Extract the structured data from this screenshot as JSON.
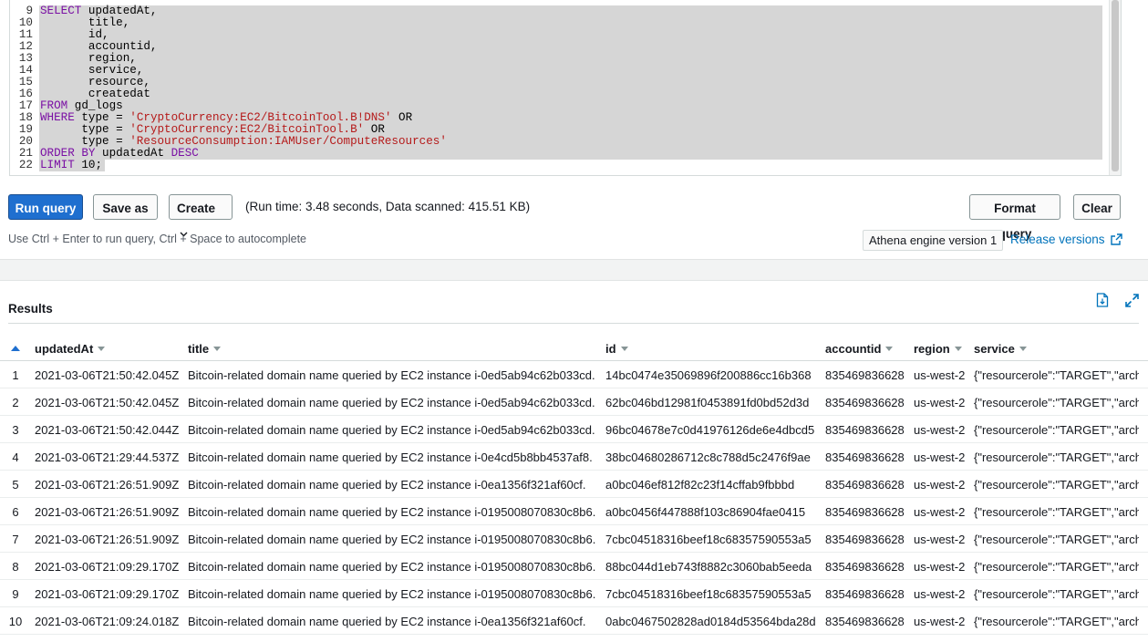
{
  "editor": {
    "lines": [
      {
        "n": "9",
        "parts": [
          {
            "t": "SELECT",
            "c": "kw"
          },
          {
            "t": " updatedAt,"
          }
        ]
      },
      {
        "n": "10",
        "parts": [
          {
            "t": "       title,"
          }
        ]
      },
      {
        "n": "11",
        "parts": [
          {
            "t": "       id,"
          }
        ]
      },
      {
        "n": "12",
        "parts": [
          {
            "t": "       accountid,"
          }
        ]
      },
      {
        "n": "13",
        "parts": [
          {
            "t": "       region,"
          }
        ]
      },
      {
        "n": "14",
        "parts": [
          {
            "t": "       service,"
          }
        ]
      },
      {
        "n": "15",
        "parts": [
          {
            "t": "       resource,"
          }
        ]
      },
      {
        "n": "16",
        "parts": [
          {
            "t": "       createdat"
          }
        ]
      },
      {
        "n": "17",
        "parts": [
          {
            "t": "FROM",
            "c": "kw"
          },
          {
            "t": " gd_logs"
          }
        ]
      },
      {
        "n": "18",
        "parts": [
          {
            "t": "WHERE",
            "c": "kw"
          },
          {
            "t": " type = "
          },
          {
            "t": "'CryptoCurrency:EC2/BitcoinTool.B!DNS'",
            "c": "str"
          },
          {
            "t": " OR"
          }
        ]
      },
      {
        "n": "19",
        "parts": [
          {
            "t": "      type = "
          },
          {
            "t": "'CryptoCurrency:EC2/BitcoinTool.B'",
            "c": "str"
          },
          {
            "t": " OR"
          }
        ]
      },
      {
        "n": "20",
        "parts": [
          {
            "t": "      type = "
          },
          {
            "t": "'ResourceConsumption:IAMUser/ComputeResources'",
            "c": "str"
          }
        ]
      },
      {
        "n": "21",
        "parts": [
          {
            "t": "ORDER BY",
            "c": "kw"
          },
          {
            "t": " updatedAt "
          },
          {
            "t": "DESC",
            "c": "kw"
          }
        ]
      },
      {
        "n": "22",
        "parts": [
          {
            "t": "LIMIT",
            "c": "kw"
          },
          {
            "t": " 10;"
          }
        ]
      }
    ]
  },
  "toolbar": {
    "run_label": "Run query",
    "save_label": "Save as",
    "create_label": "Create",
    "run_info": "(Run time: 3.48 seconds, Data scanned: 415.51 KB)",
    "format_label": "Format query",
    "clear_label": "Clear",
    "hint": "Use Ctrl + Enter to run query, Ctrl + Space to autocomplete",
    "engine": "Athena engine version 1",
    "release_label": "Release versions"
  },
  "results": {
    "title": "Results",
    "columns": [
      "updatedAt",
      "title",
      "id",
      "accountid",
      "region",
      "service"
    ],
    "rows": [
      [
        "1",
        "2021-03-06T21:50:42.045Z",
        "Bitcoin-related domain name queried by EC2 instance i-0ed5ab94c62b033cd.",
        "14bc0474e35069896f200886cc16b368",
        "835469836628",
        "us-west-2",
        "{\"resourcerole\":\"TARGET\",\"arch"
      ],
      [
        "2",
        "2021-03-06T21:50:42.045Z",
        "Bitcoin-related domain name queried by EC2 instance i-0ed5ab94c62b033cd.",
        "62bc046bd12981f0453891fd0bd52d3d",
        "835469836628",
        "us-west-2",
        "{\"resourcerole\":\"TARGET\",\"arch"
      ],
      [
        "3",
        "2021-03-06T21:50:42.044Z",
        "Bitcoin-related domain name queried by EC2 instance i-0ed5ab94c62b033cd.",
        "96bc04678e7c0d41976126de6e4dbcd5",
        "835469836628",
        "us-west-2",
        "{\"resourcerole\":\"TARGET\",\"arch"
      ],
      [
        "4",
        "2021-03-06T21:29:44.537Z",
        "Bitcoin-related domain name queried by EC2 instance i-0e4cd5b8bb4537af8.",
        "38bc04680286712c8c788d5c2476f9ae",
        "835469836628",
        "us-west-2",
        "{\"resourcerole\":\"TARGET\",\"arch"
      ],
      [
        "5",
        "2021-03-06T21:26:51.909Z",
        "Bitcoin-related domain name queried by EC2 instance i-0ea1356f321af60cf.",
        "a0bc046ef812f82c23f14cffab9fbbbd",
        "835469836628",
        "us-west-2",
        "{\"resourcerole\":\"TARGET\",\"arch"
      ],
      [
        "6",
        "2021-03-06T21:26:51.909Z",
        "Bitcoin-related domain name queried by EC2 instance i-0195008070830c8b6.",
        "a0bc0456f447888f103c86904fae0415",
        "835469836628",
        "us-west-2",
        "{\"resourcerole\":\"TARGET\",\"arch"
      ],
      [
        "7",
        "2021-03-06T21:26:51.909Z",
        "Bitcoin-related domain name queried by EC2 instance i-0195008070830c8b6.",
        "7cbc04518316beef18c68357590553a5",
        "835469836628",
        "us-west-2",
        "{\"resourcerole\":\"TARGET\",\"arch"
      ],
      [
        "8",
        "2021-03-06T21:09:29.170Z",
        "Bitcoin-related domain name queried by EC2 instance i-0195008070830c8b6.",
        "88bc044d1eb743f8882c3060bab5eeda",
        "835469836628",
        "us-west-2",
        "{\"resourcerole\":\"TARGET\",\"arch"
      ],
      [
        "9",
        "2021-03-06T21:09:29.170Z",
        "Bitcoin-related domain name queried by EC2 instance i-0195008070830c8b6.",
        "7cbc04518316beef18c68357590553a5",
        "835469836628",
        "us-west-2",
        "{\"resourcerole\":\"TARGET\",\"arch"
      ],
      [
        "10",
        "2021-03-06T21:09:24.018Z",
        "Bitcoin-related domain name queried by EC2 instance i-0ea1356f321af60cf.",
        "0abc0467502828ad0184d53564bda28d",
        "835469836628",
        "us-west-2",
        "{\"resourcerole\":\"TARGET\",\"arch"
      ]
    ]
  },
  "icons": {
    "download": "download-csv-icon",
    "expand": "expand-icon",
    "external": "external-link-icon"
  },
  "colors": {
    "primary": "#1f6fcf",
    "link": "#0073bb",
    "keyword": "#7a0fa4",
    "string": "#b51a1a"
  }
}
